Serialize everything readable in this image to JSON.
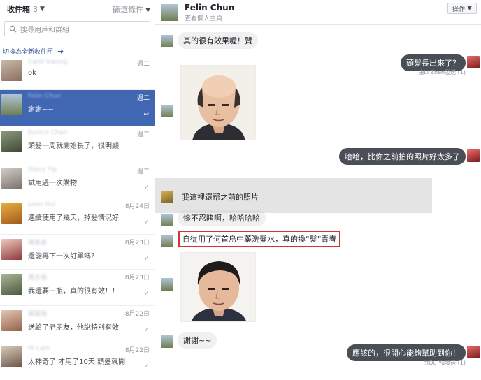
{
  "sidebar": {
    "inbox_label": "收件箱",
    "inbox_count": "3",
    "filter_label": "篩選條件",
    "search_placeholder": "搜尋用戶和群組",
    "switch_link": "切換為全新收件匣",
    "conversations": [
      {
        "name": "Carol Kwong",
        "snippet": "ok",
        "date": "週二",
        "mark": "",
        "active": false
      },
      {
        "name": "Felin Chun",
        "snippet": "謝謝~~",
        "date": "週二",
        "mark": "↩",
        "active": true
      },
      {
        "name": "Eunice Chan",
        "snippet": "頭髮一周就開始長了，很明顯",
        "date": "週二",
        "mark": "",
        "active": false
      },
      {
        "name": "Stacy Yip",
        "snippet": "試用過一次購物",
        "date": "週二",
        "mark": "✓",
        "active": false
      },
      {
        "name": "Leon Hui",
        "snippet": "連續使用了幾天，掉髮情況好",
        "date": "8月24日",
        "mark": "✓",
        "active": false
      },
      {
        "name": "陳嘉嘉",
        "snippet": "還能再下一次訂單嗎？",
        "date": "8月23日",
        "mark": "✓",
        "active": false
      },
      {
        "name": "黃志強",
        "snippet": "我還要三瓶，真的很有效！！",
        "date": "8月23日",
        "mark": "✓",
        "active": false
      },
      {
        "name": "葉國強",
        "snippet": "送給了老朋友，他說特別有效",
        "date": "8月22日",
        "mark": "✓",
        "active": false
      },
      {
        "name": "Hi Lam",
        "snippet": "太神奇了 才用了10天 頭髮就開",
        "date": "8月22日",
        "mark": "✓",
        "active": false
      }
    ]
  },
  "chat": {
    "title": "Felin Chun",
    "subtitle": "查看個人主頁",
    "action_label": "操作",
    "messages": {
      "m1": "真的很有效果喔！贊",
      "m2": "頭髮長出來了？",
      "m2_meta": "由Li Zhen發送 (1)",
      "m3": "哈哈，比你之前拍的照片好太多了",
      "m4": "我這裡還帮之前的照片",
      "m5": "慘不忍睹啊，哈哈哈哈",
      "m6": "自從用了何首烏中藥洗髮水，真的換“髮”青春",
      "m7": "謝謝~~",
      "m8": "應該的，很開心能夠幫助到你！",
      "m8_meta": "由Ou Yu發送 (1)"
    }
  },
  "colors": {
    "active_row": "#4267b2",
    "outgoing_bubble": "#4a4f57",
    "incoming_bubble": "#f1f0f0",
    "highlight_border": "#d9312b",
    "link": "#365899"
  },
  "icons": [
    "search-icon",
    "chevron-down-icon",
    "arrow-right-icon",
    "reply-icon",
    "check-icon"
  ]
}
